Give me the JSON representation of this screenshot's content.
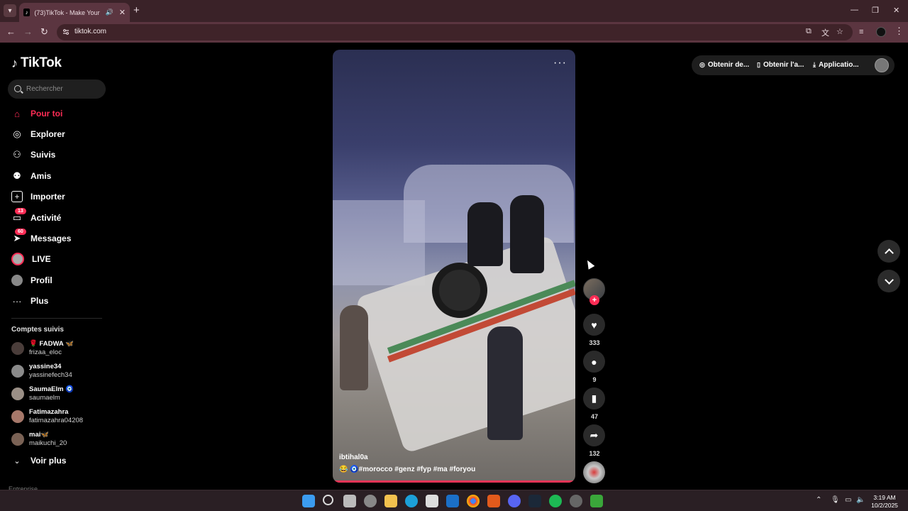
{
  "browser": {
    "tab_title": "(73)TikTok - Make Your Day",
    "url": "tiktok.com"
  },
  "sidebar": {
    "logo": "TikTok",
    "search_placeholder": "Rechercher",
    "nav": [
      {
        "label": "Pour toi",
        "icon": "home-icon",
        "active": true
      },
      {
        "label": "Explorer",
        "icon": "compass-icon"
      },
      {
        "label": "Suivis",
        "icon": "following-icon"
      },
      {
        "label": "Amis",
        "icon": "friends-icon"
      },
      {
        "label": "Importer",
        "icon": "upload-icon"
      },
      {
        "label": "Activité",
        "icon": "activity-icon",
        "badge": "13"
      },
      {
        "label": "Messages",
        "icon": "messages-icon",
        "badge": "60"
      },
      {
        "label": "LIVE",
        "icon": "live-icon"
      },
      {
        "label": "Profil",
        "icon": "profile-avatar-icon"
      },
      {
        "label": "Plus",
        "icon": "more-icon"
      }
    ],
    "following_title": "Comptes suivis",
    "accounts": [
      {
        "name": "🌹 FADWA 🦋",
        "handle": "frizaa_eloc"
      },
      {
        "name": "yassine34",
        "handle": "yassinefech34"
      },
      {
        "name": "SaumaElm 🧿",
        "handle": "saumaelm"
      },
      {
        "name": "Fatimazahra",
        "handle": "fatimazahra04208"
      },
      {
        "name": "mai🦋",
        "handle": "maikuchi_20"
      }
    ],
    "see_more": "Voir plus",
    "cutoff_text": "Entreprise"
  },
  "video": {
    "author": "ibtihal0a",
    "caption": "😂 🧿#morocco #genz #fyp #ma #foryou"
  },
  "actions": {
    "likes": "333",
    "comments": "9",
    "saves": "47",
    "shares": "132"
  },
  "topbar": {
    "item1": "Obtenir de...",
    "item2": "Obtenir l'a...",
    "item3": "Applicatio..."
  },
  "taskbar": {
    "time": "3:19 AM",
    "date": "10/2/2025"
  },
  "colors": {
    "accent": "#fe2c55",
    "chrome_tab": "#5b3540"
  }
}
